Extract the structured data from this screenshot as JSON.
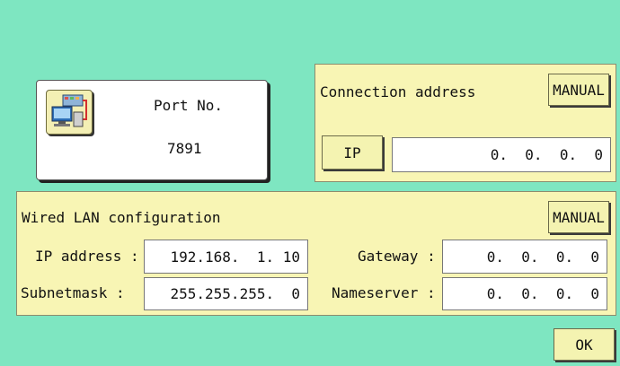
{
  "port": {
    "label": "Port No.",
    "value": "7891",
    "icon": "network-computer-icon"
  },
  "connection": {
    "title": "Connection address",
    "manual_label": "MANUAL",
    "ip_button": "IP",
    "ip_value": "0.  0.  0.  0"
  },
  "wired": {
    "title": "Wired LAN configuration",
    "manual_label": "MANUAL",
    "ip_address_label": "IP address :",
    "ip_address_value": "192.168.  1. 10",
    "subnet_label": "Subnetmask :",
    "subnet_value": "255.255.255.  0",
    "gateway_label": "Gateway :",
    "gateway_value": "0.  0.  0.  0",
    "nameserver_label": "Nameserver :",
    "nameserver_value": "0.  0.  0.  0"
  },
  "ok_label": "OK"
}
